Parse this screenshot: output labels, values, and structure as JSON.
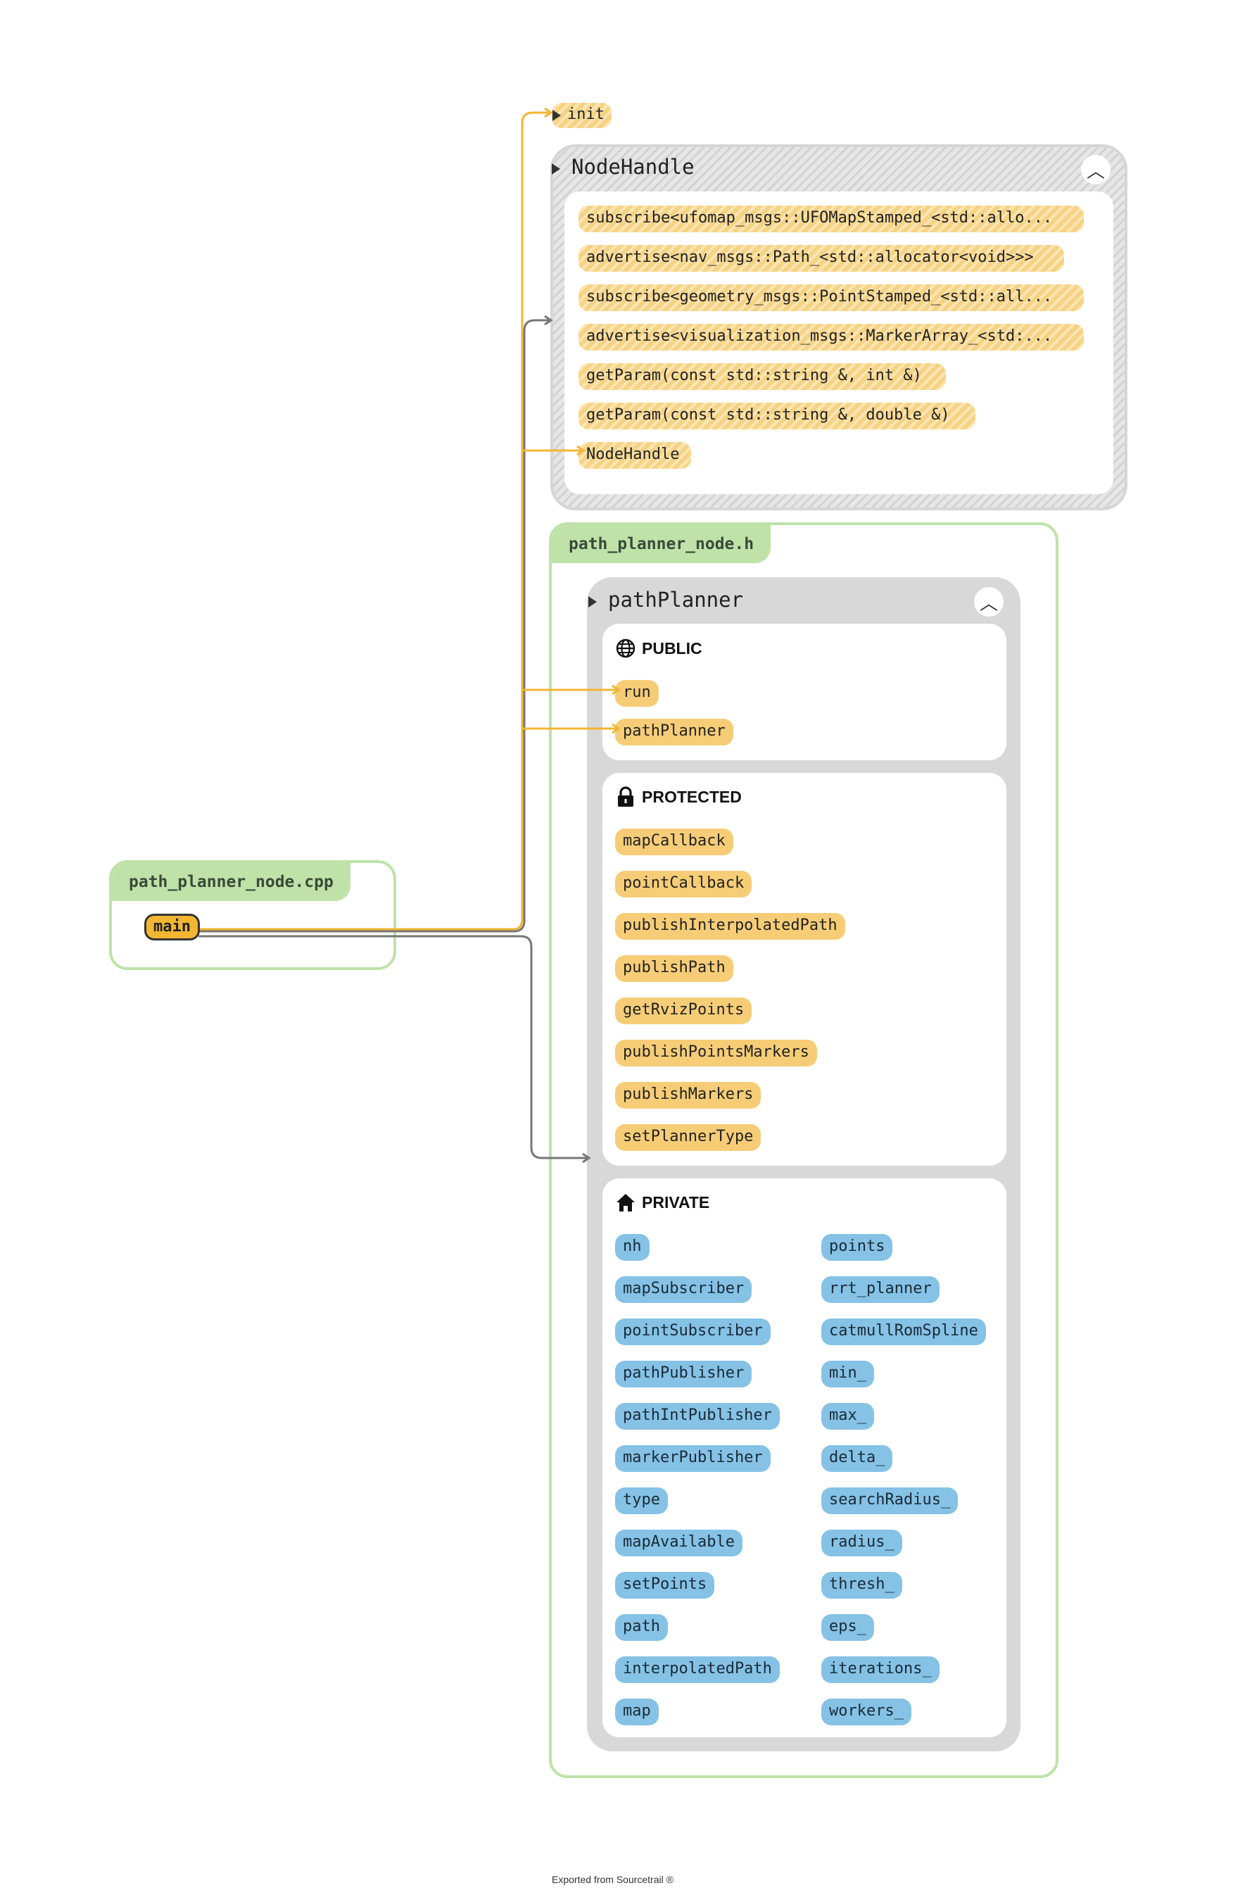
{
  "colors": {
    "function_node": "#f6cd76",
    "variable_node": "#85c2e6",
    "file_container": "#bfe2a8",
    "class_box": "#d8d8d8",
    "call_edge": "#f2b632",
    "type_use_edge": "#777777"
  },
  "cpp_file": {
    "name": "path_planner_node.cpp",
    "main": "main"
  },
  "init_node": "init",
  "nodehandle": {
    "title": "NodeHandle",
    "collapse_glyph": "︿",
    "members": [
      "subscribe<ufomap_msgs::UFOMapStamped_<std::allo...",
      "advertise<nav_msgs::Path_<std::allocator<void>>>",
      "subscribe<geometry_msgs::PointStamped_<std::all...",
      "advertise<visualization_msgs::MarkerArray_<std:...",
      "getParam(const std::string &, int &)",
      "getParam(const std::string &, double &)",
      "NodeHandle"
    ]
  },
  "header_file": {
    "name": "path_planner_node.h"
  },
  "class": {
    "title": "pathPlanner",
    "collapse_glyph": "︿",
    "public": {
      "label": "PUBLIC",
      "icon": "globe-icon",
      "members": [
        "run",
        "pathPlanner"
      ]
    },
    "protected": {
      "label": "PROTECTED",
      "icon": "lock-icon",
      "members": [
        "mapCallback",
        "pointCallback",
        "publishInterpolatedPath",
        "publishPath",
        "getRvizPoints",
        "publishPointsMarkers",
        "publishMarkers",
        "setPlannerType"
      ]
    },
    "private": {
      "label": "PRIVATE",
      "icon": "house-icon",
      "left": [
        "nh",
        "mapSubscriber",
        "pointSubscriber",
        "pathPublisher",
        "pathIntPublisher",
        "markerPublisher",
        "type",
        "mapAvailable",
        "setPoints",
        "path",
        "interpolatedPath",
        "map"
      ],
      "right": [
        "points",
        "rrt_planner",
        "catmullRomSpline",
        "min_",
        "max_",
        "delta_",
        "searchRadius_",
        "radius_",
        "thresh_",
        "eps_",
        "iterations_",
        "workers_"
      ]
    }
  },
  "footer": "Exported from Sourcetrail ®"
}
